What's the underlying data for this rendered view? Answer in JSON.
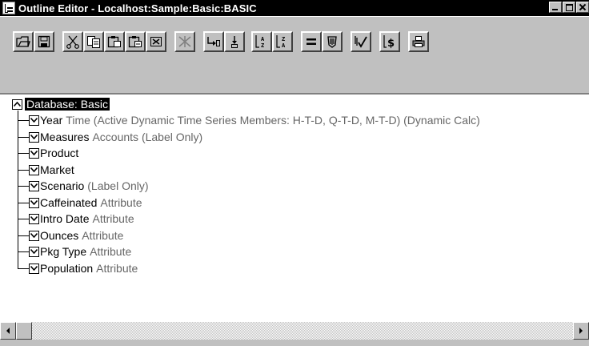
{
  "window": {
    "title": "Outline Editor - Localhost:Sample:Basic:BASIC"
  },
  "toolbar": {
    "buttons": [
      {
        "name": "open-icon"
      },
      {
        "name": "save-icon"
      },
      {
        "name": "cut-icon"
      },
      {
        "name": "copy-icon"
      },
      {
        "name": "paste-child-icon"
      },
      {
        "name": "paste-sibling-icon"
      },
      {
        "name": "delete-icon"
      },
      {
        "name": "expand-icon"
      },
      {
        "name": "add-child-icon"
      },
      {
        "name": "add-sibling-icon"
      },
      {
        "name": "sort-ascending-icon"
      },
      {
        "name": "sort-descending-icon"
      },
      {
        "name": "formula-icon"
      },
      {
        "name": "filter-icon"
      },
      {
        "name": "verify-icon"
      },
      {
        "name": "currency-icon"
      },
      {
        "name": "print-icon"
      }
    ]
  },
  "tree": {
    "root": "Database: Basic",
    "items": [
      {
        "name": "Year",
        "desc": "Time (Active Dynamic Time Series Members: H-T-D, Q-T-D, M-T-D) (Dynamic Calc)"
      },
      {
        "name": "Measures",
        "desc": "Accounts (Label Only)"
      },
      {
        "name": "Product",
        "desc": ""
      },
      {
        "name": "Market",
        "desc": ""
      },
      {
        "name": "Scenario",
        "desc": "(Label Only)"
      },
      {
        "name": "Caffeinated",
        "desc": "Attribute"
      },
      {
        "name": "Intro Date",
        "desc": "Attribute"
      },
      {
        "name": "Ounces",
        "desc": "Attribute"
      },
      {
        "name": "Pkg Type",
        "desc": "Attribute"
      },
      {
        "name": "Population",
        "desc": "Attribute"
      }
    ]
  }
}
